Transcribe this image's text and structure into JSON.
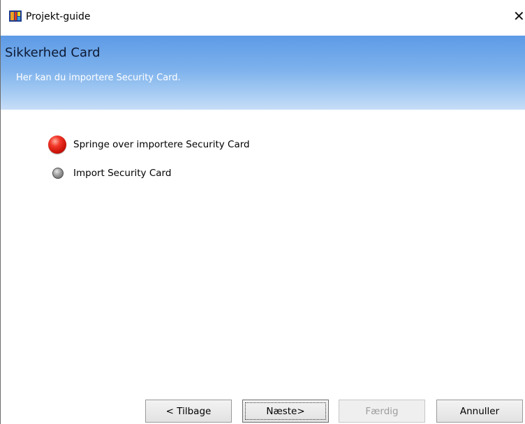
{
  "window": {
    "title": "Projekt-guide",
    "icon": "app-icon"
  },
  "banner": {
    "title": "Sikkerhed Card",
    "subtitle": "Her kan du importere Security Card."
  },
  "options": [
    {
      "label": "Springe over importere Security Card",
      "selected": true
    },
    {
      "label": "Import Security Card",
      "selected": false
    }
  ],
  "buttons": {
    "back": "< Tilbage",
    "next": "Næste>",
    "finish": "Færdig",
    "cancel": "Annuller"
  },
  "colors": {
    "banner_top": "#5d9ae6",
    "banner_bottom": "#c8def7",
    "selected_radio": "#cc1409",
    "unselected_radio": "#8a8a8a"
  }
}
